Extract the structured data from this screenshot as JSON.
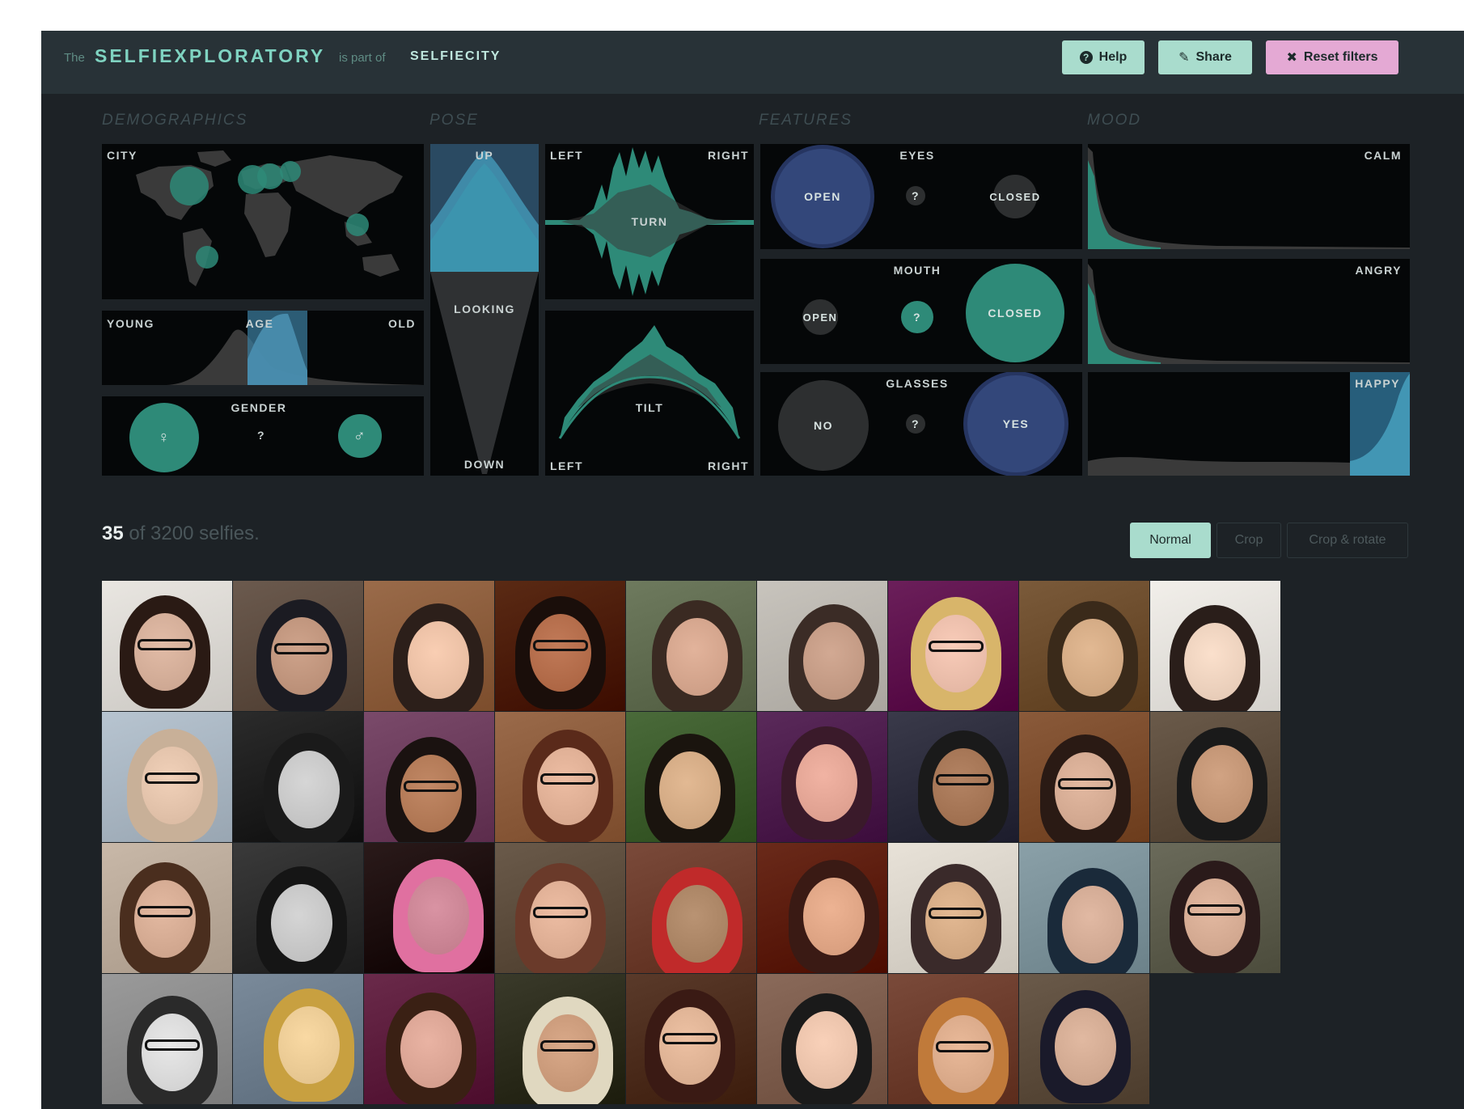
{
  "header": {
    "prefix": "The",
    "app_name": "SELFIEXPLORATORY",
    "part_of": "is part of",
    "parent_name": "SELFIECITY",
    "buttons": {
      "help": {
        "icon": "help-circle-icon",
        "label": "Help"
      },
      "share": {
        "icon": "paperclip-icon",
        "label": "Share"
      },
      "reset": {
        "icon": "close-x-icon",
        "label": "Reset filters"
      }
    }
  },
  "sections": {
    "demographics": "DEMOGRAPHICS",
    "pose": "POSE",
    "features": "FEATURES",
    "mood": "MOOD"
  },
  "demographics": {
    "city": {
      "label": "CITY"
    },
    "age": {
      "label": "AGE",
      "left": "YOUNG",
      "right": "OLD"
    },
    "gender": {
      "label": "GENDER",
      "female": "♀",
      "unknown": "?",
      "male": "♂"
    }
  },
  "pose": {
    "looking": {
      "label": "LOOKING",
      "up": "UP",
      "down": "DOWN"
    },
    "turn": {
      "label": "TURN",
      "left": "LEFT",
      "right": "RIGHT"
    },
    "tilt": {
      "label": "TILT",
      "left": "LEFT",
      "right": "RIGHT"
    }
  },
  "features": {
    "eyes": {
      "label": "EYES",
      "open": "OPEN",
      "unknown": "?",
      "closed": "CLOSED"
    },
    "mouth": {
      "label": "MOUTH",
      "open": "OPEN",
      "unknown": "?",
      "closed": "CLOSED"
    },
    "glasses": {
      "label": "GLASSES",
      "no": "NO",
      "unknown": "?",
      "yes": "YES"
    }
  },
  "mood": {
    "calm": "CALM",
    "angry": "ANGRY",
    "happy": "HAPPY"
  },
  "results": {
    "count": "35",
    "total_text": "of 3200 selfies."
  },
  "view_modes": {
    "normal": "Normal",
    "crop": "Crop",
    "crop_rotate": "Crop & rotate",
    "selected": "Normal"
  },
  "colors": {
    "teal": "#2e8a78",
    "blue": "#33477a",
    "accent_green": "#a9dccd",
    "accent_pink": "#e4a9d4",
    "background": "#1d2226"
  }
}
